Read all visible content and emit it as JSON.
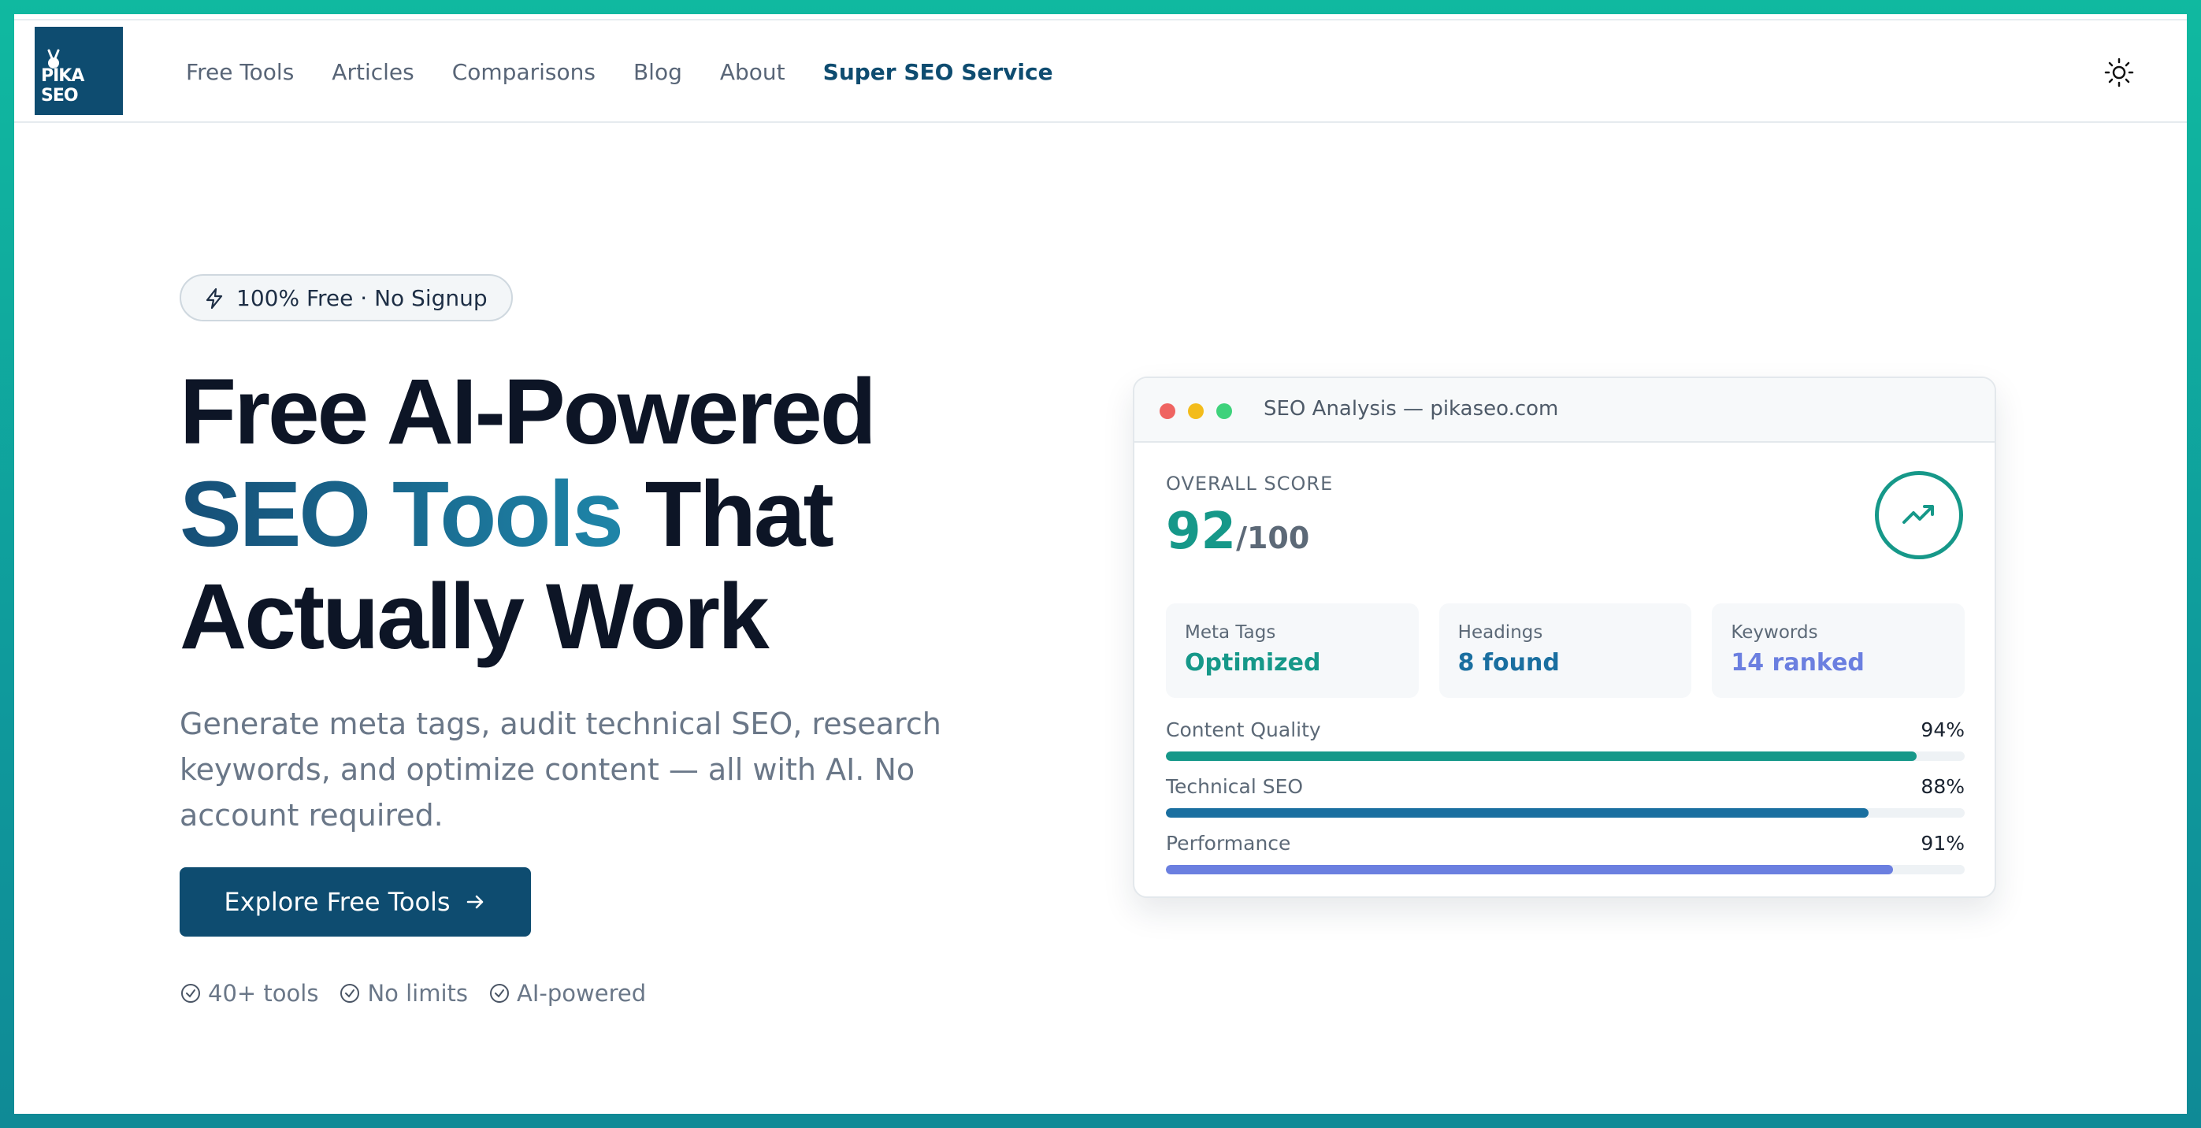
{
  "brand": {
    "logo_text": "PIKA SEO"
  },
  "nav": {
    "items": [
      {
        "label": "Free Tools"
      },
      {
        "label": "Articles"
      },
      {
        "label": "Comparisons"
      },
      {
        "label": "Blog"
      },
      {
        "label": "About"
      },
      {
        "label": "Super SEO Service"
      }
    ],
    "theme_icon": "sun-icon"
  },
  "hero": {
    "badge": "100% Free · No Signup",
    "headline_line1": "Free AI-Powered",
    "headline_highlight": "SEO Tools",
    "headline_line2_rest": " That",
    "headline_line3": "Actually Work",
    "subtext": "Generate meta tags, audit technical SEO, research keywords, and optimize content — all with AI. No account required.",
    "cta_label": "Explore Free Tools",
    "features": [
      {
        "label": "40+ tools"
      },
      {
        "label": "No limits"
      },
      {
        "label": "AI-powered"
      }
    ]
  },
  "card": {
    "title": "SEO Analysis — pikaseo.com",
    "score_label": "OVERALL SCORE",
    "score_value": "92",
    "score_max": "/100",
    "metrics": [
      {
        "label": "Meta Tags",
        "value": "Optimized",
        "color": "#169889"
      },
      {
        "label": "Headings",
        "value": "8 found",
        "color": "#1a6fa0"
      },
      {
        "label": "Keywords",
        "value": "14 ranked",
        "color": "#6b7fe0"
      }
    ],
    "bars": [
      {
        "label": "Content Quality",
        "pct_label": "94%",
        "value": 94,
        "color": "#169889"
      },
      {
        "label": "Technical SEO",
        "pct_label": "88%",
        "value": 88,
        "color": "#1a6fa0"
      },
      {
        "label": "Performance",
        "pct_label": "91%",
        "value": 91,
        "color": "#6b7fe0"
      }
    ]
  },
  "colors": {
    "primary": "#0e4c70",
    "teal": "#169889",
    "blue": "#1a6fa0",
    "indigo": "#6b7fe0"
  }
}
